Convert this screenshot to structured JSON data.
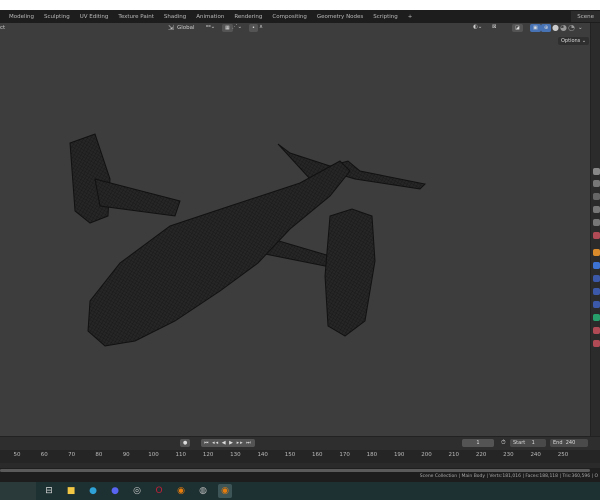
{
  "workspace_tabs": [
    "Modeling",
    "Sculpting",
    "UV Editing",
    "Texture Paint",
    "Shading",
    "Animation",
    "Rendering",
    "Compositing",
    "Geometry Nodes",
    "Scripting",
    "+"
  ],
  "scene": "Scene",
  "viewport_header": {
    "left_label": "ct",
    "orientation": "Global",
    "options": "Options"
  },
  "timeline": {
    "current_frame": "1",
    "start_label": "Start",
    "start": "1",
    "end_label": "End",
    "end": "240",
    "ruler": [
      "50",
      "60",
      "70",
      "80",
      "90",
      "100",
      "110",
      "120",
      "130",
      "140",
      "150",
      "160",
      "170",
      "180",
      "190",
      "200",
      "210",
      "220",
      "230",
      "240",
      "250"
    ]
  },
  "status_bar": "Scene Collection | Main Body | Verts:181,016 | Faces:188,118 | Tris:360,596 | O",
  "taskbar": [
    {
      "name": "task-view",
      "glyph": "⊟",
      "color": "#dddddd"
    },
    {
      "name": "file-explorer",
      "glyph": "■",
      "color": "#f2c744"
    },
    {
      "name": "edge",
      "glyph": "●",
      "color": "#2fa3d8"
    },
    {
      "name": "discord",
      "glyph": "●",
      "color": "#5865f2"
    },
    {
      "name": "app",
      "glyph": "◎",
      "color": "#cccccc"
    },
    {
      "name": "opera",
      "glyph": "O",
      "color": "#c0203a"
    },
    {
      "name": "blender",
      "glyph": "◉",
      "color": "#e87d0d"
    },
    {
      "name": "obs",
      "glyph": "◍",
      "color": "#bbbbbb"
    },
    {
      "name": "blender-active",
      "glyph": "◉",
      "color": "#e87d0d"
    }
  ]
}
